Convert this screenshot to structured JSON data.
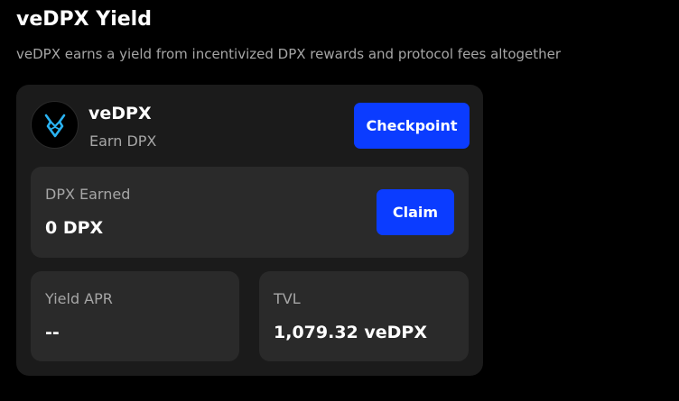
{
  "header": {
    "title": "veDPX Yield",
    "subtitle": "veDPX earns a yield from incentivized DPX rewards and protocol fees altogether"
  },
  "card": {
    "token_icon": "dopex-bull-logo-icon",
    "token_name": "veDPX",
    "token_caption": "Earn DPX",
    "checkpoint_label": "Checkpoint",
    "earned": {
      "label": "DPX Earned",
      "value": "0 DPX",
      "claim_label": "Claim"
    },
    "apr": {
      "label": "Yield APR",
      "value": "--"
    },
    "tvl": {
      "label": "TVL",
      "value": "1,079.32 veDPX"
    }
  },
  "colors": {
    "background": "#000000",
    "card": "#1b1b1b",
    "panel": "#2a2a2a",
    "accent": "#0b3cff",
    "logo_accent": "#2ab3f2",
    "muted_text": "#a6a6a6"
  }
}
